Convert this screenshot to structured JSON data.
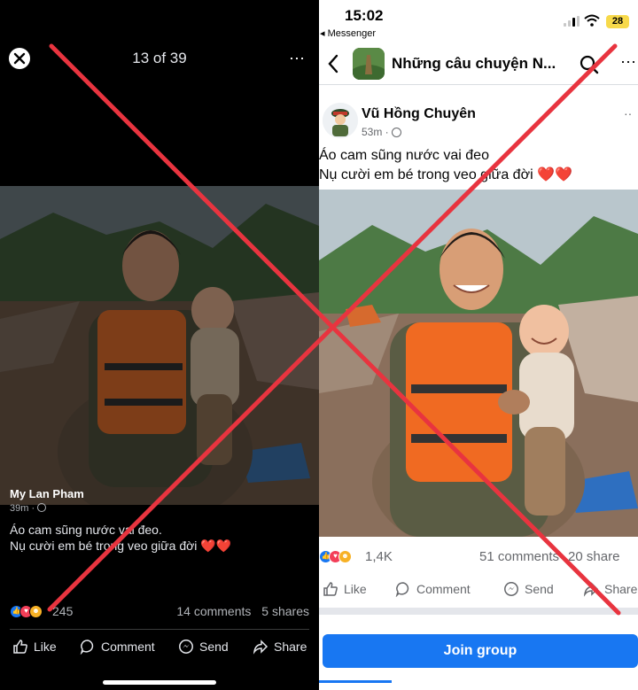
{
  "left_viewer": {
    "counter": "13 of 39",
    "more_icon": "⋯",
    "author": "My Lan Pham",
    "time": "39m ·",
    "caption_line1": "Áo cam sũng nước vai đeo.",
    "caption_line2": "Nụ cười em bé trong veo giữa đời",
    "hearts": "❤️❤️",
    "reaction_count": "245",
    "comments": "14 comments",
    "shares": "5 shares",
    "actions": {
      "like": "Like",
      "comment": "Comment",
      "send": "Send",
      "share": "Share"
    }
  },
  "right_feed": {
    "status_time": "15:02",
    "back_app": "◂ Messenger",
    "battery": "28",
    "group_title": "Những câu chuyện N...",
    "more_icon": "⋯",
    "author": "Vũ Hồng Chuyên",
    "time": "53m ·",
    "post_more": "··",
    "caption_line1": "Áo cam sũng nước vai đeo",
    "caption_line2": "Nụ cười em bé trong veo giữa đời",
    "hearts": "❤️❤️",
    "reaction_count": "1,4K",
    "comments": "51 comments",
    "shares": "20 share",
    "actions": {
      "like": "Like",
      "comment": "Comment",
      "send": "Send",
      "share": "Share"
    },
    "join_button": "Join group"
  },
  "colors": {
    "accent": "#1877f2",
    "cross": "#e8343f",
    "dark_bg": "#000000"
  },
  "icons": [
    "close-icon",
    "more-icon",
    "globe-icon",
    "like-reaction-icon",
    "love-reaction-icon",
    "care-reaction-icon",
    "thumbs-up-icon",
    "comment-icon",
    "messenger-send-icon",
    "share-arrow-icon",
    "back-chevron-icon",
    "search-icon",
    "wifi-icon",
    "signal-icon",
    "battery-icon"
  ]
}
